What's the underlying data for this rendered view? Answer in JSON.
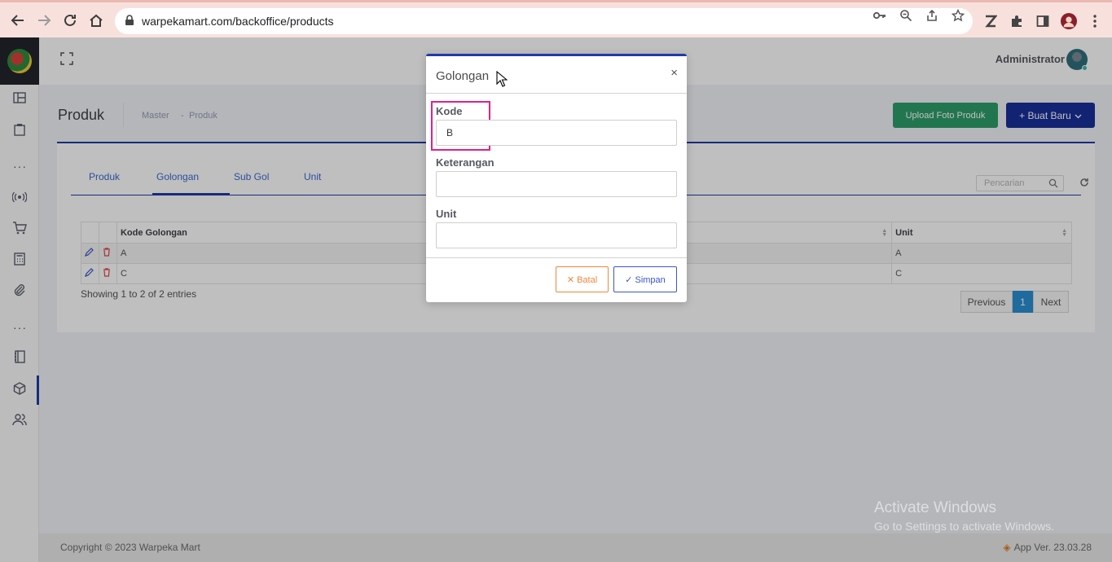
{
  "browser": {
    "url": "warpekamart.com/backoffice/products"
  },
  "header": {
    "user_name": "Administrator"
  },
  "subheader": {
    "title": "Produk",
    "breadcrumb": [
      "Master",
      "-",
      "Produk"
    ],
    "upload_button": "Upload Foto Produk",
    "create_button": "+ Buat Baru"
  },
  "tabs": [
    "Produk",
    "Golongan",
    "Sub Gol",
    "Unit"
  ],
  "active_tab": "Golongan",
  "search": {
    "placeholder": "Pencarian"
  },
  "table": {
    "columns": [
      "Kode Golongan",
      "Unit"
    ],
    "rows": [
      {
        "kode": "A",
        "unit": "A"
      },
      {
        "kode": "C",
        "unit": "C"
      }
    ]
  },
  "showing_text": "Showing 1 to 2 of 2 entries",
  "pagination": {
    "previous": "Previous",
    "current": "1",
    "next": "Next"
  },
  "footer": {
    "copyright": "Copyright © 2023 Warpeka Mart",
    "version": "App Ver. 23.03.28"
  },
  "watermark": {
    "title": "Activate Windows",
    "subtitle": "Go to Settings to activate Windows."
  },
  "modal": {
    "title": "Golongan",
    "close": "×",
    "fields": {
      "kode": {
        "label": "Kode",
        "value": "B"
      },
      "keterangan": {
        "label": "Keterangan",
        "value": ""
      },
      "unit": {
        "label": "Unit",
        "value": ""
      }
    },
    "cancel_button": "✕ Batal",
    "save_button": "✓ Simpan"
  },
  "colors": {
    "primary": "#1f3aa8",
    "success": "#2e9e6a",
    "cancel": "#f0873c",
    "highlight": "#e0208a"
  }
}
